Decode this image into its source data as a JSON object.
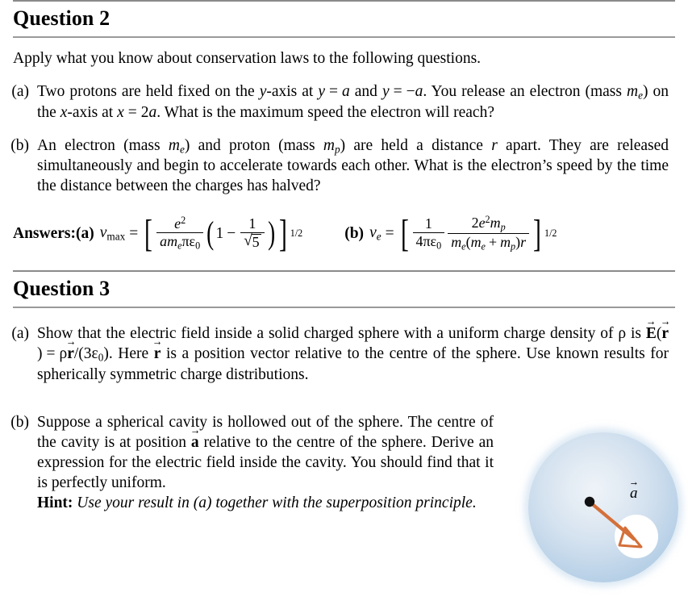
{
  "document": {
    "questions": [
      {
        "id": "question-2",
        "heading": "Question 2",
        "intro": "Apply what you know about conservation laws to the following questions.",
        "items": [
          {
            "label": "(a)",
            "text_segments": [
              "Two protons are held fixed on the ",
              "y",
              "-axis at ",
              "y = a",
              " and ",
              "y = −a",
              ". You release an electron (mass ",
              "m_e",
              ") on the ",
              "x",
              "-axis at ",
              "x = 2a",
              ". What is the maximum speed the electron will reach?"
            ]
          },
          {
            "label": "(b)",
            "text_segments": [
              "An electron (mass ",
              "m_e",
              ") and proton (mass ",
              "m_p",
              ") are held a distance ",
              "r",
              " apart. They are released simultaneously and begin to accelerate towards each other. What is the electron’s speed by the time the distance between the charges has halved?"
            ]
          }
        ]
      },
      {
        "id": "question-3",
        "heading": "Question 3",
        "items": [
          {
            "label": "(a)",
            "text_segments": [
              "Show that the electric field inside a solid charged sphere with a uniform charge density of ",
              "ρ",
              " is ",
              "E⃗(r⃗) = ρr⃗/(3ϵ₀)",
              ". Here ",
              "r⃗",
              " is a position vector relative to the centre of the sphere. Use known results for spherically symmetric charge distributions."
            ]
          },
          {
            "label": "(b)",
            "text_segments": [
              "Suppose a spherical cavity is hollowed out of the sphere. The centre of the cavity is at position ",
              "a⃗",
              " relative to the centre of the sphere. Derive an expression for the electric field inside the cavity. You should find that it is perfectly uniform."
            ],
            "hint_label": "Hint:",
            "hint_text": "Use your result in (a) together with the superposition principle."
          }
        ]
      }
    ]
  },
  "answers": {
    "label": "Answers:",
    "a": {
      "tag": "(a)",
      "variable": "v",
      "variable_sub": "max",
      "equals": "=",
      "bracket_open": "[",
      "bracket_close": "]",
      "numerator": "e",
      "numerator_exp": "2",
      "denominator_a": "a",
      "denominator_m": "m",
      "denominator_m_sub": "e",
      "denominator_pi": "π",
      "denominator_eps": "ϵ",
      "denominator_eps_sub": "0",
      "paren_open": "(",
      "paren_close": ")",
      "one": "1",
      "minus": "−",
      "frac_num": "1",
      "sqrt_value": "5",
      "exponent": "1/2",
      "plain": "v_max = [ e^2 / (a m_e πϵ_0) (1 − 1/√5) ]^(1/2)"
    },
    "b": {
      "tag": "(b)",
      "variable": "v",
      "variable_sub": "e",
      "equals": "=",
      "bracket_open": "[",
      "bracket_close": "]",
      "f1_num": "1",
      "f1_den_4": "4",
      "f1_den_pi": "π",
      "f1_den_eps": "ϵ",
      "f1_den_eps_sub": "0",
      "f2_num_2": "2",
      "f2_num_e": "e",
      "f2_num_e_exp": "2",
      "f2_num_m": "m",
      "f2_num_m_sub": "p",
      "f2_den": "m",
      "f2_den_sub": "e",
      "f2_den_open": "(",
      "f2_den_m1": "m",
      "f2_den_m1_sub": "e",
      "f2_den_plus": "+",
      "f2_den_m2": "m",
      "f2_den_m2_sub": "p",
      "f2_den_close": ")",
      "f2_den_r": "r",
      "exponent": "1/2",
      "plain": "v_e = [ 1/(4πϵ_0) · 2e^2 m_p / (m_e(m_e+m_p)r) ]^(1/2)"
    }
  },
  "figure": {
    "name": "sphere-with-cavity-diagram",
    "vector_label": "a",
    "sphere_color_center": "#eef3f8",
    "sphere_color_rim": "#aecbe4",
    "cavity_color": "#ffffff",
    "arrow_color": "#d4703a",
    "dot_color": "#111111"
  },
  "colors": {
    "rule": "#8a8a8a",
    "text": "#000000",
    "background": "#ffffff"
  }
}
